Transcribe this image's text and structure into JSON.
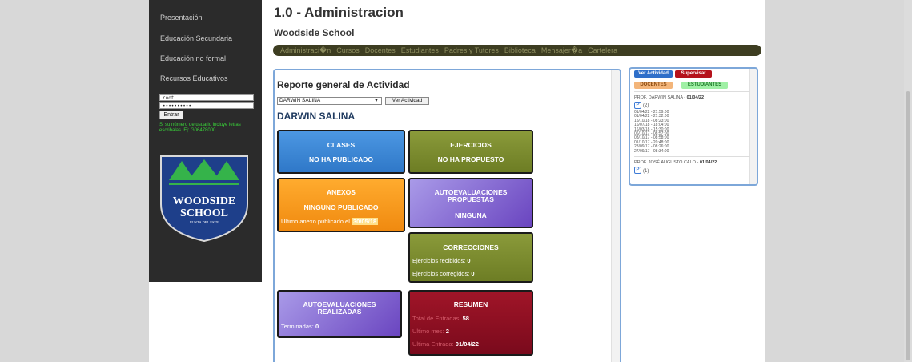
{
  "sidebar": {
    "items": [
      {
        "label": "Presentación"
      },
      {
        "label": "Educación Secundaria"
      },
      {
        "label": "Educación no formal"
      },
      {
        "label": "Recursos Educativos"
      }
    ],
    "login": {
      "user_value": "root",
      "password_value": "••••••••••",
      "button_label": "Entrar",
      "hint": "Si su número de usuario incluye letras escribalas. Ej: G06478000"
    },
    "logo": {
      "line1": "WOODSIDE",
      "line2": "SCHOOL",
      "line3": "PUNTA DEL ESTE"
    }
  },
  "header": {
    "title": "1.0 - Administracion",
    "school": "Woodside School"
  },
  "nav": {
    "items": [
      {
        "label": "Administraci�n"
      },
      {
        "label": "Cursos"
      },
      {
        "label": "Docentes"
      },
      {
        "label": "Estudiantes"
      },
      {
        "label": "Padres y Tutores"
      },
      {
        "label": "Biblioteca"
      },
      {
        "label": "Mensajer�a"
      },
      {
        "label": "Cartelera"
      }
    ]
  },
  "report": {
    "title": "Reporte general de Actividad",
    "select_value": "DARWIN SALINA",
    "button_label": "Ver Actividad",
    "teacher_name": "DARWIN SALINA",
    "cards": {
      "clases": {
        "title": "CLASES",
        "status": "NO HA PUBLICADO"
      },
      "ejercicios": {
        "title": "EJERCICIOS",
        "status": "NO HA PROPUESTO"
      },
      "anexos": {
        "title": "ANEXOS",
        "status": "NINGUNO PUBLICADO",
        "last_label": "Ultimo anexo publicado el",
        "last_value": "30/05/18"
      },
      "autoeval_propuestas": {
        "title_line1": "AUTOEVALUACIONES",
        "title_line2": "PROPUESTAS",
        "status": "NINGUNA"
      },
      "correcciones": {
        "title": "CORRECCIONES",
        "recibidos_label": "Ejercicios recibidos:",
        "recibidos_value": "0",
        "corregidos_label": "Ejercicios corregidos:",
        "corregidos_value": "0"
      },
      "autoeval_realizadas": {
        "title_line1": "AUTOEVALUACIONES",
        "title_line2": "REALIZADAS",
        "terminadas_label": "Terminadas:",
        "terminadas_value": "0"
      },
      "resumen": {
        "title": "RESUMEN",
        "total_label": "Total de Entradas:",
        "total_value": "58",
        "mes_label": "Ultimo mes:",
        "mes_value": "2",
        "ultima_label": "Ultima Entrada:",
        "ultima_value": "01/04/22"
      }
    }
  },
  "side": {
    "btn_ver": "Ver Actividad",
    "btn_supervisar": "Supervisar",
    "tab_docentes": "DOCENTES",
    "tab_estudiantes": "ESTUDIANTES",
    "entry1": {
      "label": "PROF. DARWIN SALINA -",
      "date": "01/04/22",
      "count": "(2)",
      "times": [
        "01/04/22 - 21:59:00",
        "01/04/22 - 21:32:00",
        "15/10/18 - 08:23:00",
        "16/07/18 - 18:04:00",
        "16/03/18 - 15:30:00",
        "06/10/17 - 08:57:00",
        "03/10/17 - 08:58:00",
        "01/10/17 - 20:48:00",
        "28/09/17 - 08:26:00",
        "27/09/17 - 08:34:00"
      ]
    },
    "entry2": {
      "label": "PROF. JOSÉ AUGUSTO CALO -",
      "date": "01/04/22",
      "count": "(1)"
    }
  },
  "colors": {
    "sidebar_bg": "#2b2b2b",
    "nav_bg": "#3d3d21",
    "panel_border": "#7da7d9",
    "card_blue": "#3b87d6",
    "card_olive": "#7a8a2e",
    "card_orange": "#f69a1f",
    "card_purple": "#7a55c8",
    "card_darkred": "#8c0f23"
  }
}
